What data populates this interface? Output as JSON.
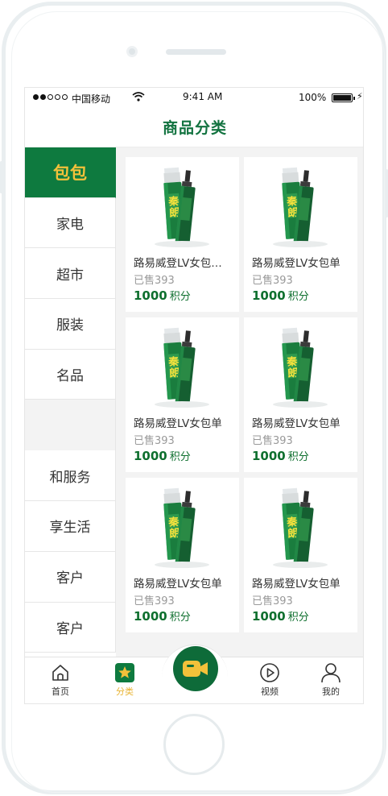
{
  "status_bar": {
    "carrier": "中国移动",
    "time": "9:41 AM",
    "battery": "100%"
  },
  "nav": {
    "title": "商品分类"
  },
  "categories": [
    {
      "label": "包包",
      "active": true
    },
    {
      "label": "家电"
    },
    {
      "label": "超市"
    },
    {
      "label": "服装"
    },
    {
      "label": "名品"
    },
    {
      "label": ""
    },
    {
      "label": "和服务"
    },
    {
      "label": "享生活"
    },
    {
      "label": "客户"
    },
    {
      "label": "客户"
    }
  ],
  "products": [
    {
      "name": "路易威登LV女包…",
      "sold": "已售393",
      "price": "1000",
      "unit": "积分"
    },
    {
      "name": "路易威登LV女包单",
      "sold": "已售393",
      "price": "1000",
      "unit": "积分"
    },
    {
      "name": "路易威登LV女包单",
      "sold": "已售393",
      "price": "1000",
      "unit": "积分"
    },
    {
      "name": "路易威登LV女包单",
      "sold": "已售393",
      "price": "1000",
      "unit": "积分"
    },
    {
      "name": "路易威登LV女包单",
      "sold": "已售393",
      "price": "1000",
      "unit": "积分"
    },
    {
      "name": "路易威登LV女包单",
      "sold": "已售393",
      "price": "1000",
      "unit": "积分"
    }
  ],
  "product_image_label": "秦朗",
  "tabs": [
    {
      "label": "首页",
      "icon": "home-icon"
    },
    {
      "label": "分类",
      "icon": "category-star-icon",
      "active": true
    },
    {
      "label": "",
      "icon": "video-camera-icon"
    },
    {
      "label": "视频",
      "icon": "play-icon"
    },
    {
      "label": "我的",
      "icon": "user-icon"
    }
  ],
  "colors": {
    "brand_green": "#0e7a3f",
    "accent_yellow": "#f3c13a",
    "price_green": "#0e6f2e"
  }
}
